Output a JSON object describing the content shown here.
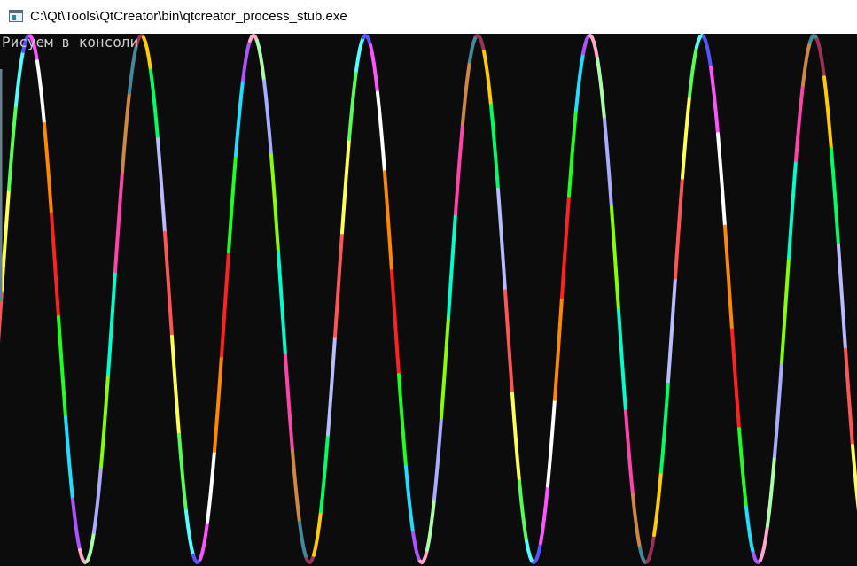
{
  "window": {
    "title": "C:\\Qt\\Tools\\QtCreator\\bin\\qtcreator_process_stub.exe",
    "icon": "console-window-icon"
  },
  "console": {
    "text": "Рисуем в консоли",
    "background": "#0c0c0c",
    "text_color": "#cccccc"
  },
  "drawing": {
    "shape": "sine-wave",
    "full_periods": 7,
    "segment_colors": [
      "#ff5555",
      "#ffff55",
      "#55ff55",
      "#55ffff",
      "#5555ff",
      "#ff55ff",
      "#ffffff",
      "#ff8800",
      "#ff2222",
      "#22ff22",
      "#22ddff",
      "#aa55ff",
      "#ffaacc",
      "#aaffaa",
      "#aaaaff",
      "#88ff00",
      "#00ffcc",
      "#ff44aa",
      "#cc8844",
      "#448899",
      "#993355",
      "#ffcc00",
      "#00ff66",
      "#bbbbff"
    ]
  }
}
